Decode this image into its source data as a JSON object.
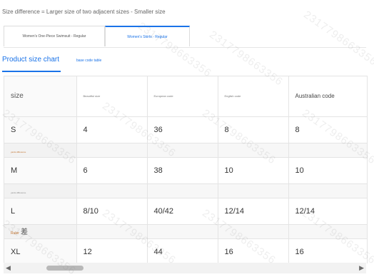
{
  "note": "Size difference = Larger size of two adjacent sizes - Smaller size",
  "tabs": [
    {
      "label": "Women's One-Piece Swimsuit - Regular"
    },
    {
      "label": "Women's Skirts - Regular"
    }
  ],
  "subtabs": {
    "active": "Product size chart",
    "other": "base code table"
  },
  "table": {
    "headers": [
      "size",
      "Beautiful size",
      "European code",
      "English code",
      "Australian code"
    ],
    "rows": {
      "s": [
        "S",
        "4",
        "36",
        "8",
        "8"
      ],
      "m": [
        "M",
        "6",
        "38",
        "10",
        "10"
      ],
      "l": [
        "L",
        "8/10",
        "40/42",
        "12/14",
        "12/14"
      ],
      "xl": [
        "XL",
        "12",
        "44",
        "16",
        "16"
      ]
    },
    "diff_labels": {
      "after_s": "yards difference",
      "after_m": "yards difference",
      "after_l": "Ruler",
      "after_l_glyph": "差"
    }
  },
  "scrollbar": {
    "left_arrow": "◀",
    "right_arrow": "▶"
  },
  "watermark": "2317798663356",
  "colors": {
    "accent": "#1a73e8",
    "border": "#e4e4e4",
    "diff_label": "#c0702a"
  }
}
